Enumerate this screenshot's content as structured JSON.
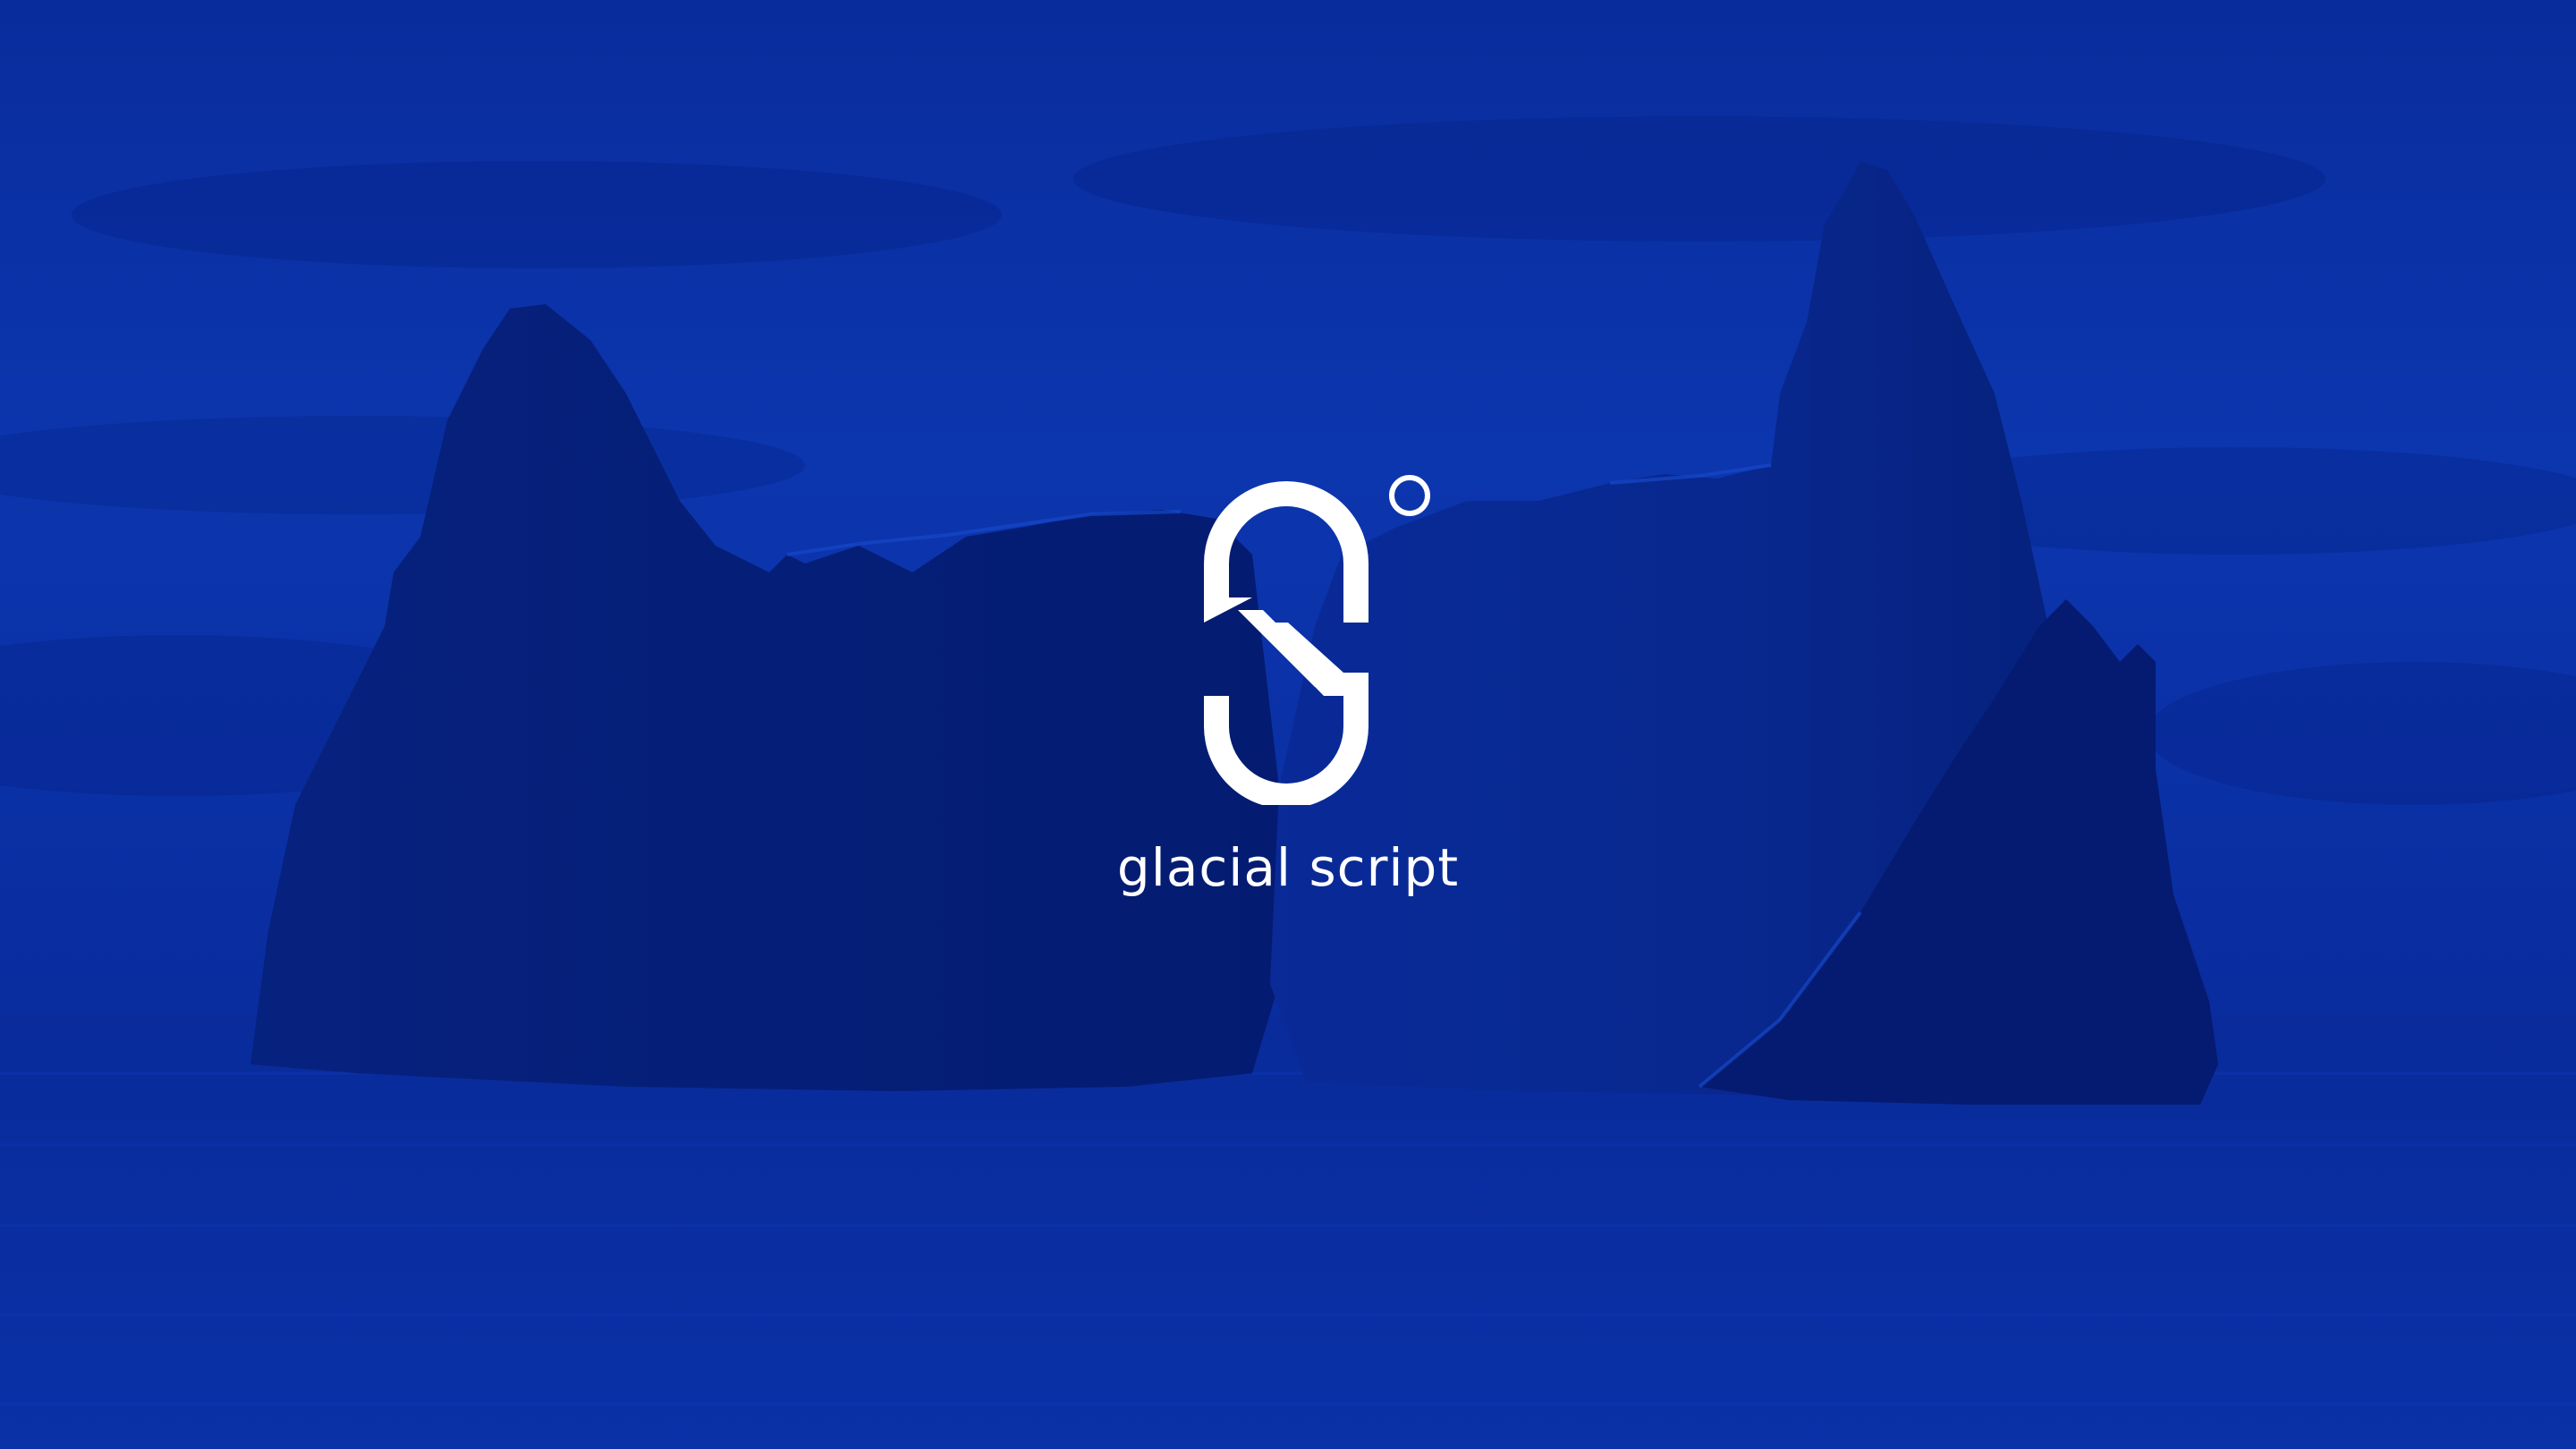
{
  "brand": {
    "name": "glacial script",
    "logo_icon": "s-degree-logo-icon"
  },
  "scene": {
    "description_icon": "iceberg-seascape",
    "tint_color": "#0b2fa3",
    "mark_color": "#ffffff"
  }
}
